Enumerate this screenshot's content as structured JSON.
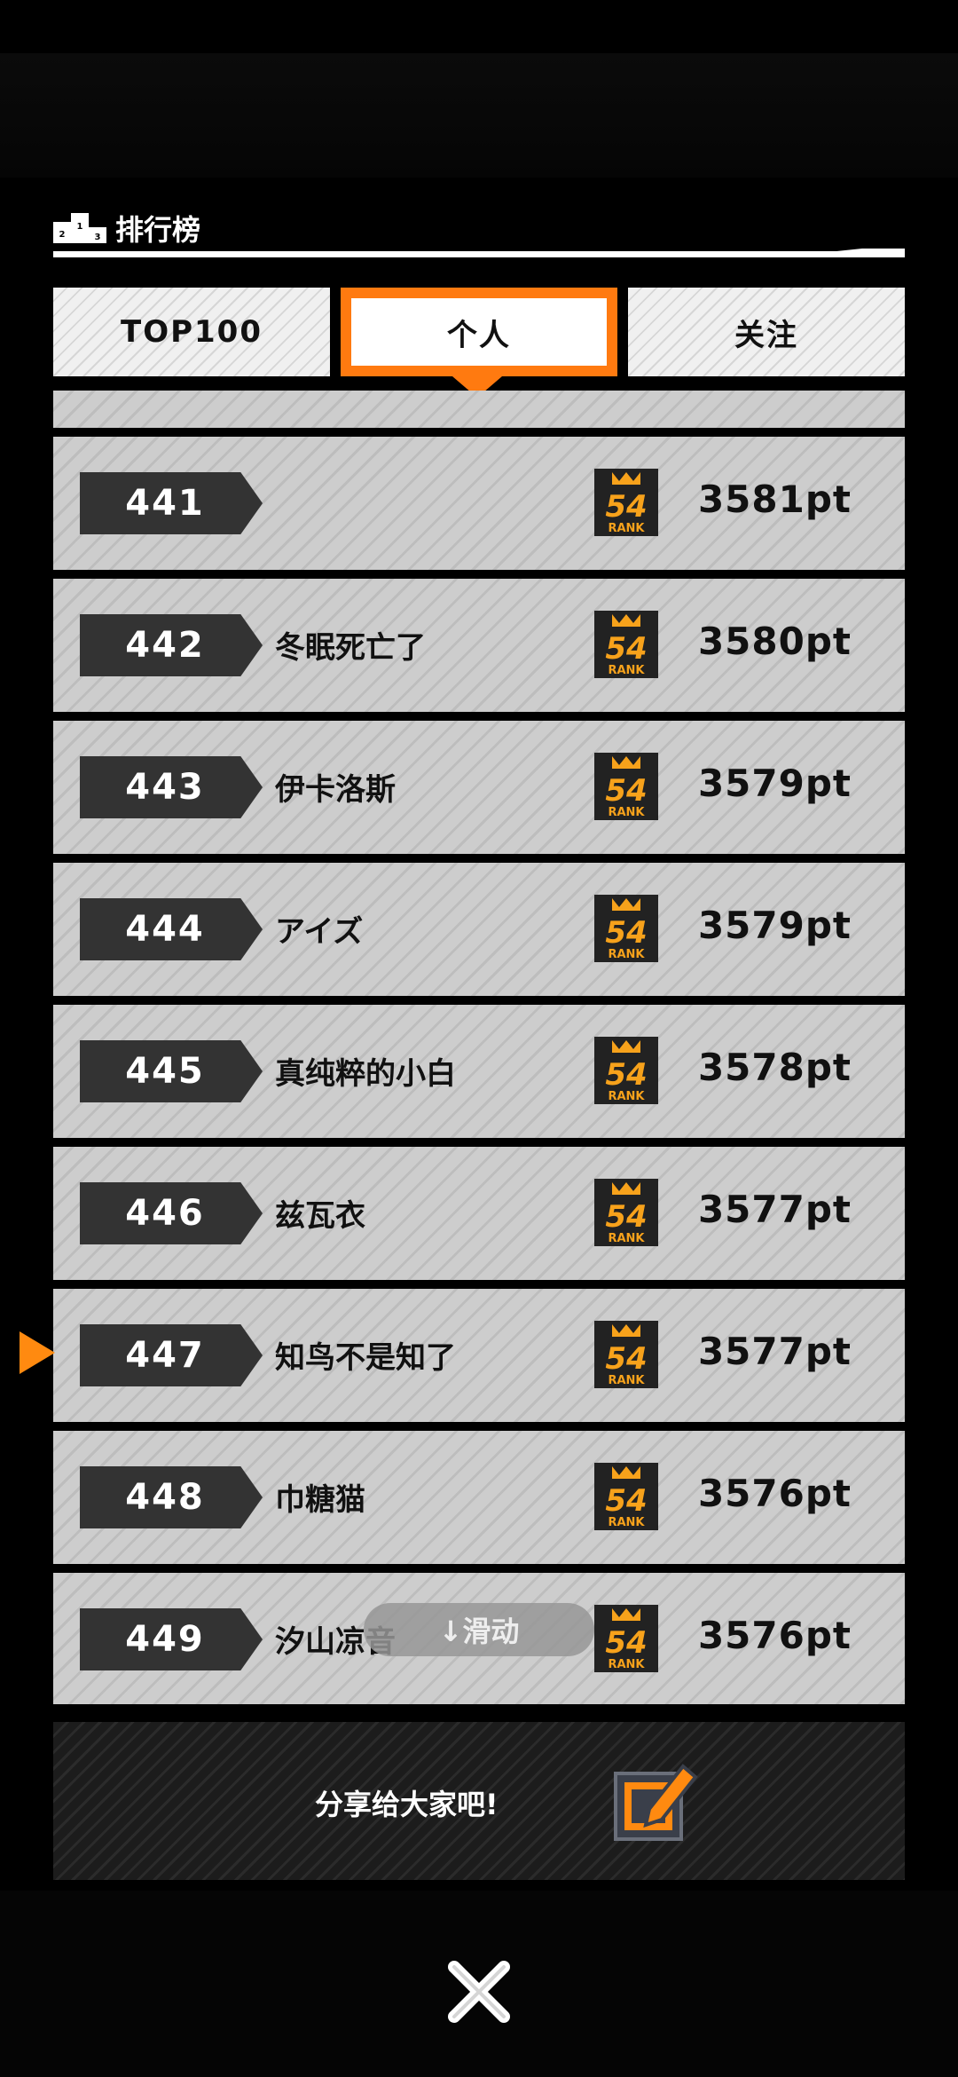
{
  "header": {
    "title": "排行榜"
  },
  "tabs": [
    {
      "label": "TOP100",
      "selected": false
    },
    {
      "label": "个人",
      "selected": true
    },
    {
      "label": "关注",
      "selected": false
    }
  ],
  "rank_icon_label": "54 RANK",
  "rows": [
    {
      "rank": "441",
      "name": "",
      "score": "3581pt"
    },
    {
      "rank": "442",
      "name": "冬眠死亡了",
      "score": "3580pt"
    },
    {
      "rank": "443",
      "name": "伊卡洛斯",
      "score": "3579pt"
    },
    {
      "rank": "444",
      "name": "アイズ",
      "score": "3579pt"
    },
    {
      "rank": "445",
      "name": "真纯粹的小白",
      "score": "3578pt"
    },
    {
      "rank": "446",
      "name": "兹瓦衣",
      "score": "3577pt"
    },
    {
      "rank": "447",
      "name": "知鸟不是知了",
      "score": "3577pt"
    },
    {
      "rank": "448",
      "name": "巾糖猫",
      "score": "3576pt"
    },
    {
      "rank": "449",
      "name": "汐山凉音",
      "score": "3576pt"
    }
  ],
  "scroll_hint": "↓滑动",
  "share": {
    "label": "分享给大家吧!"
  },
  "colors": {
    "accent": "#ff7a10",
    "badge": "#333333",
    "rank_gold": "#f7a21b"
  }
}
